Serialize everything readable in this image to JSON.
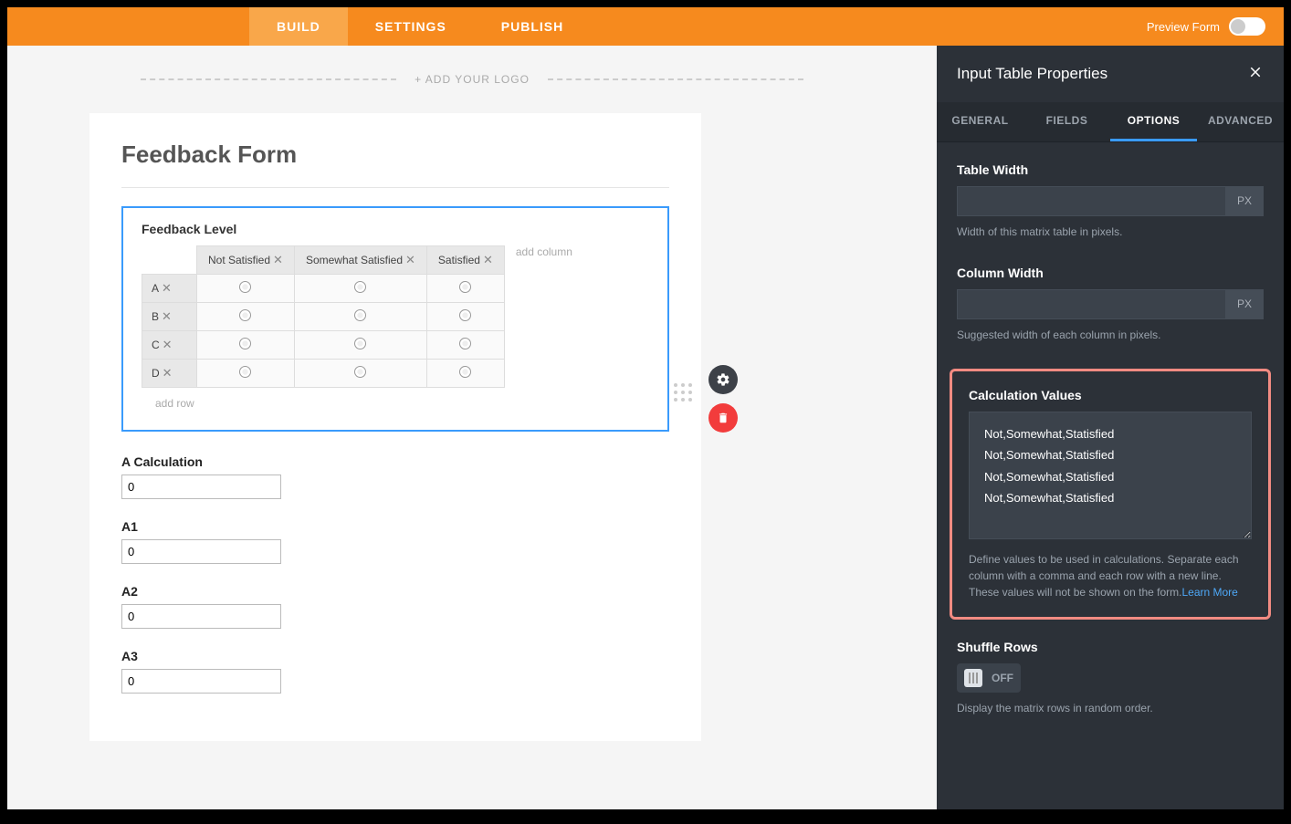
{
  "topbar": {
    "tabs": [
      "BUILD",
      "SETTINGS",
      "PUBLISH"
    ],
    "preview_label": "Preview Form"
  },
  "canvas": {
    "add_logo": "+ ADD YOUR LOGO",
    "form_title": "Feedback Form",
    "table": {
      "label": "Feedback Level",
      "columns": [
        "Not Satisfied",
        "Somewhat Satisfied",
        "Satisfied"
      ],
      "rows": [
        "A",
        "B",
        "C",
        "D"
      ],
      "add_column": "add column",
      "add_row": "add row"
    },
    "fields": [
      {
        "label": "A Calculation",
        "value": "0"
      },
      {
        "label": "A1",
        "value": "0"
      },
      {
        "label": "A2",
        "value": "0"
      },
      {
        "label": "A3",
        "value": "0"
      }
    ]
  },
  "panel": {
    "title": "Input Table Properties",
    "tabs": [
      "GENERAL",
      "FIELDS",
      "OPTIONS",
      "ADVANCED"
    ],
    "table_width": {
      "label": "Table Width",
      "unit": "PX",
      "help": "Width of this matrix table in pixels."
    },
    "column_width": {
      "label": "Column Width",
      "unit": "PX",
      "help": "Suggested width of each column in pixels."
    },
    "calc": {
      "label": "Calculation Values",
      "value": "Not,Somewhat,Statisfied\nNot,Somewhat,Statisfied\nNot,Somewhat,Statisfied\nNot,Somewhat,Statisfied",
      "help": "Define values to be used in calculations. Separate each column with a comma and each row with a new line. These values will not be shown on the form.",
      "learn_more": "Learn More"
    },
    "shuffle": {
      "label": "Shuffle Rows",
      "state": "OFF",
      "help": "Display the matrix rows in random order."
    }
  }
}
